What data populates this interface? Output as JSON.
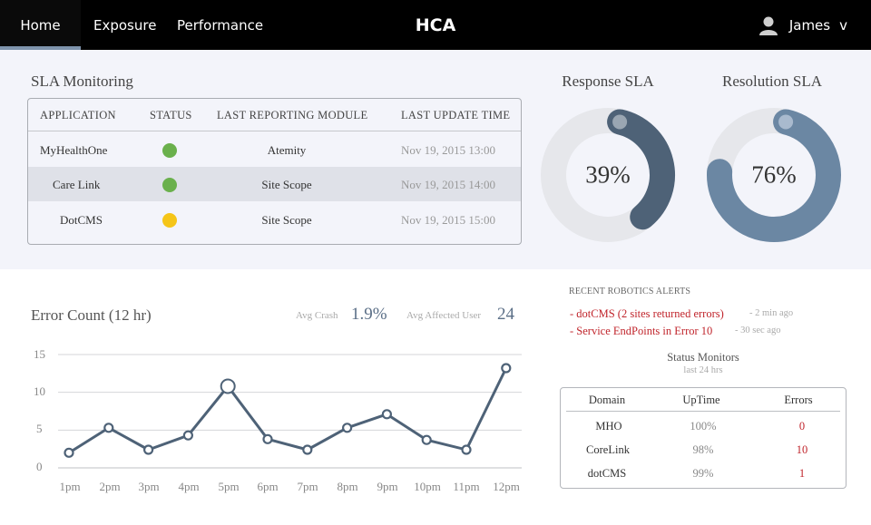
{
  "nav": {
    "tabs": [
      {
        "label": "Home",
        "active": true
      },
      {
        "label": "Exposure",
        "active": false
      },
      {
        "label": "Performance",
        "active": false
      }
    ],
    "brand": "HCA",
    "user": {
      "name": "James",
      "caret": "v"
    }
  },
  "sla_monitoring": {
    "title": "SLA Monitoring",
    "columns": [
      "APPLICATION",
      "STATUS",
      "LAST REPORTING MODULE",
      "LAST UPDATE TIME"
    ],
    "rows": [
      {
        "application": "MyHealthOne",
        "status": "green",
        "module": "Atemity",
        "time": "Nov 19, 2015 13:00"
      },
      {
        "application": "Care Link",
        "status": "green",
        "module": "Site Scope",
        "time": "Nov 19, 2015 14:00"
      },
      {
        "application": "DotCMS",
        "status": "yellow",
        "module": "Site Scope",
        "time": "Nov 19, 2015 15:00"
      }
    ],
    "status_colors": {
      "green": "#6ab04c",
      "yellow": "#f5c518"
    }
  },
  "response_sla": {
    "title": "Response SLA",
    "value": "39%",
    "fraction": 0.39,
    "color": "#4e6277"
  },
  "resolution_sla": {
    "title": "Resolution SLA",
    "value": "76%",
    "fraction": 0.76,
    "color": "#6b87a3"
  },
  "error_count": {
    "title": "Error Count (12 hr)",
    "avg_crash_label": "Avg Crash",
    "avg_crash_value": "1.9%",
    "avg_affected_label": "Avg Affected User",
    "avg_affected_value": "24"
  },
  "chart_data": {
    "type": "line",
    "title": "Error Count (12 hr)",
    "categories": [
      "1pm",
      "2pm",
      "3pm",
      "4pm",
      "5pm",
      "6pm",
      "7pm",
      "8pm",
      "9pm",
      "10pm",
      "11pm",
      "12pm"
    ],
    "values": [
      2,
      5.3,
      2.4,
      4.3,
      10.8,
      3.8,
      2.4,
      5.3,
      7.1,
      3.7,
      2.4,
      13.2
    ],
    "highlight_index": 4,
    "yticks": [
      "15",
      "10",
      "5",
      "0"
    ],
    "ylim": [
      0,
      15
    ],
    "grid": true,
    "color": "#4e6277"
  },
  "robotics_alerts": {
    "title": "RECENT ROBOTICS ALERTS",
    "items": [
      {
        "text": "- dotCMS (2 sites returned errors)",
        "time": "- 2 min ago"
      },
      {
        "text": "- Service EndPoints in Error 10",
        "time": "- 30 sec ago"
      }
    ]
  },
  "status_monitors": {
    "title": "Status Monitors",
    "subtitle": "last 24 hrs",
    "columns": [
      "Domain",
      "UpTime",
      "Errors"
    ],
    "rows": [
      {
        "domain": "MHO",
        "uptime": "100%",
        "errors": "0"
      },
      {
        "domain": "CoreLink",
        "uptime": "98%",
        "errors": "10"
      },
      {
        "domain": "dotCMS",
        "uptime": "99%",
        "errors": "1"
      }
    ]
  }
}
